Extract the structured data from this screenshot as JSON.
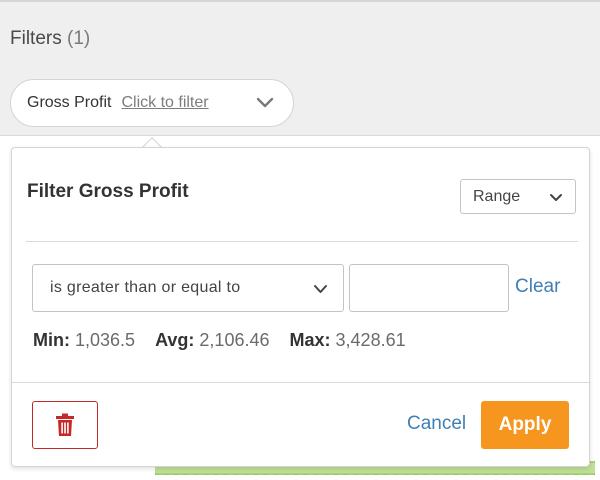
{
  "filters_bar": {
    "title": "Filters",
    "count": "(1)",
    "pill": {
      "field": "Gross Profit",
      "link_text": "Click to filter",
      "icon": "chevron-down-icon"
    }
  },
  "popover": {
    "title": "Filter Gross Profit",
    "mode_select": {
      "value": "Range",
      "icon": "chevron-down-icon"
    },
    "operator_select": {
      "value": "is greater than or equal to",
      "icon": "chevron-down-icon"
    },
    "value_input": {
      "value": "",
      "placeholder": ""
    },
    "clear_label": "Clear",
    "stats": [
      {
        "label": "Min:",
        "value": "1,036.5"
      },
      {
        "label": "Avg:",
        "value": "2,106.46"
      },
      {
        "label": "Max:",
        "value": "3,428.61"
      }
    ],
    "footer": {
      "delete_icon": "trash-icon",
      "cancel_label": "Cancel",
      "apply_label": "Apply"
    }
  },
  "colors": {
    "accent_link": "#3f7fb3",
    "apply_button": "#f7961e",
    "delete_red": "#c62828",
    "bar_background": "#efefef"
  }
}
